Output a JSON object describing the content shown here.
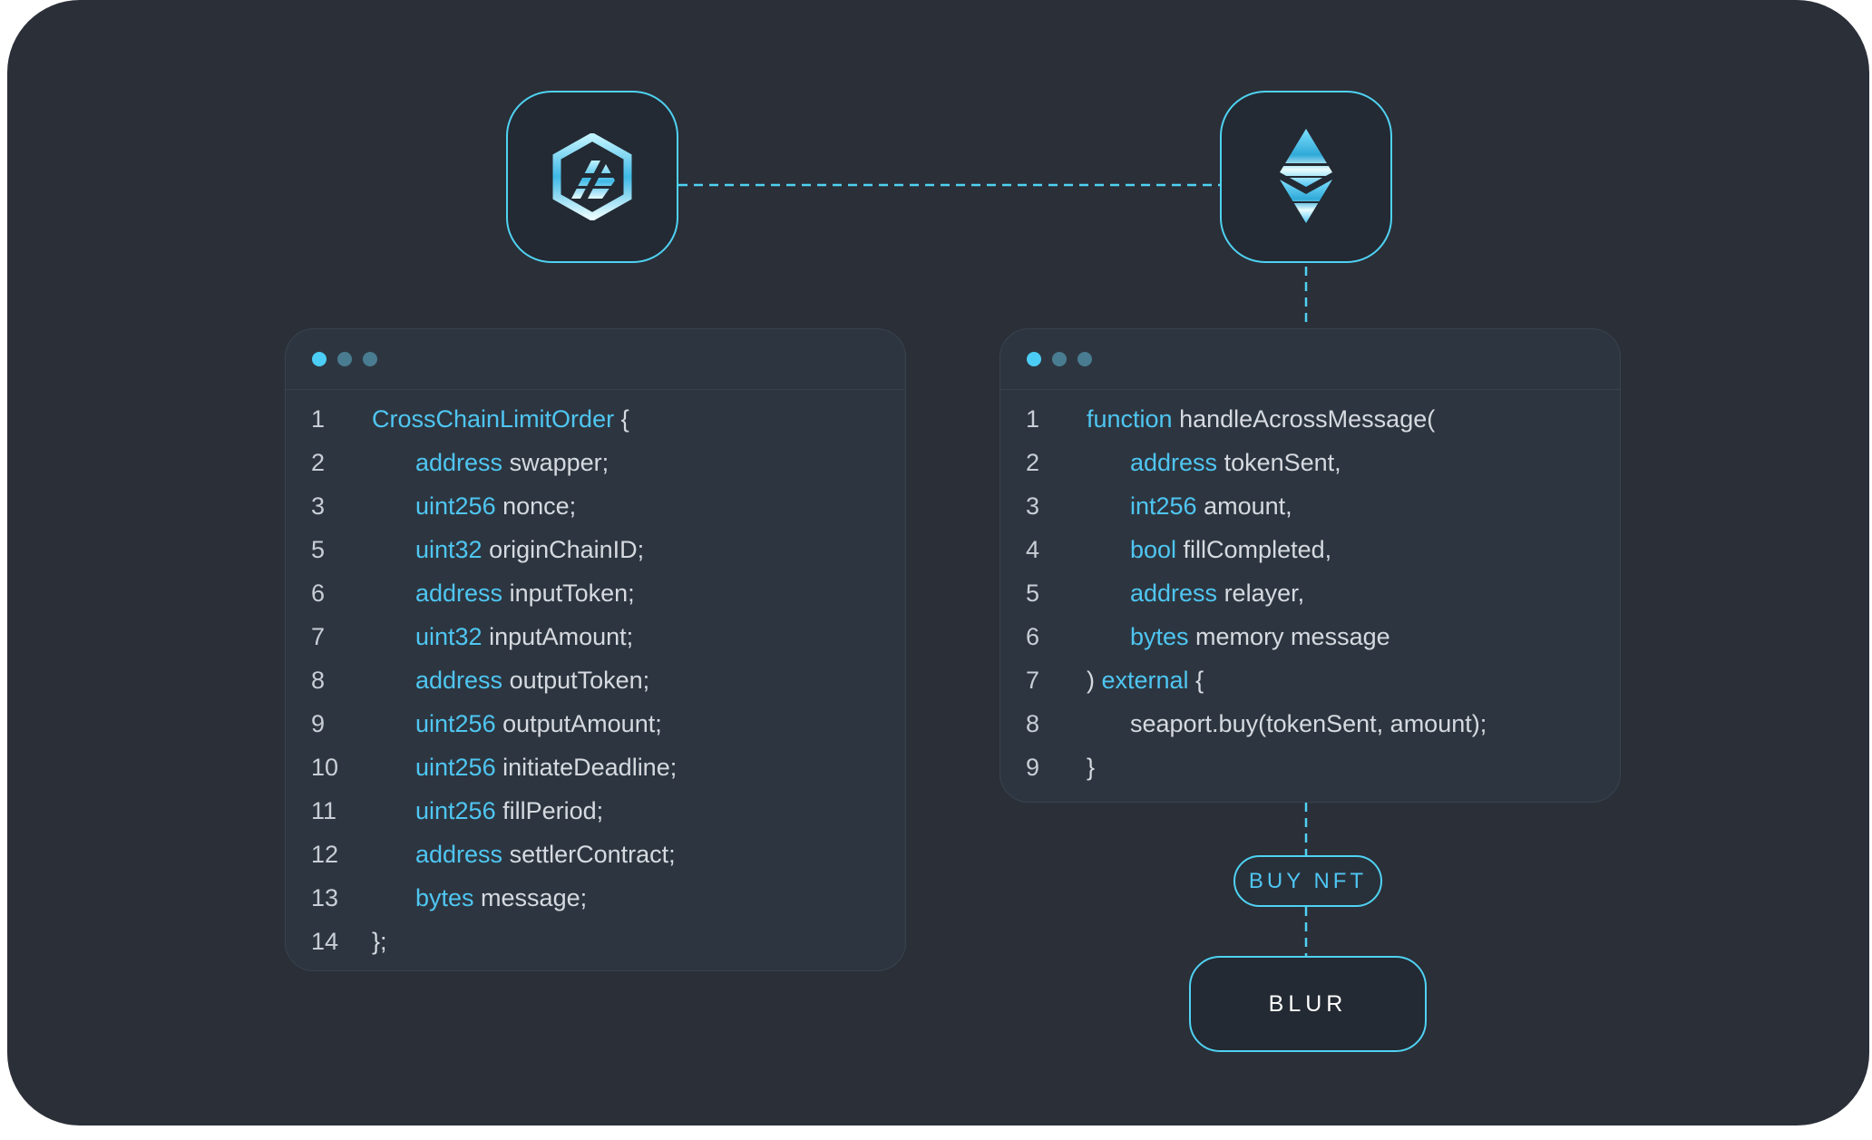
{
  "colors": {
    "background": "#2b2f38",
    "accent": "#4fd2f2",
    "keyword": "#4fc6f2",
    "text": "#d6dae0"
  },
  "nodes": {
    "across": {
      "icon": "across-protocol-logo-icon"
    },
    "ethereum": {
      "icon": "ethereum-logo-icon"
    }
  },
  "left_panel": {
    "lines": [
      {
        "n": "1",
        "kw": "CrossChainLimitOrder",
        "rest": " {",
        "indent": false
      },
      {
        "n": "2",
        "kw": "address",
        "rest": " swapper;",
        "indent": true
      },
      {
        "n": "3",
        "kw": "uint256",
        "rest": " nonce;",
        "indent": true
      },
      {
        "n": "5",
        "kw": "uint32",
        "rest": " originChainID;",
        "indent": true
      },
      {
        "n": "6",
        "kw": "address",
        "rest": " inputToken;",
        "indent": true
      },
      {
        "n": "7",
        "kw": "uint32",
        "rest": " inputAmount;",
        "indent": true
      },
      {
        "n": "8",
        "kw": "address",
        "rest": " outputToken;",
        "indent": true
      },
      {
        "n": "9",
        "kw": "uint256",
        "rest": " outputAmount;",
        "indent": true
      },
      {
        "n": "10",
        "kw": "uint256",
        "rest": " initiateDeadline;",
        "indent": true
      },
      {
        "n": "11",
        "kw": "uint256",
        "rest": " fillPeriod;",
        "indent": true
      },
      {
        "n": "12",
        "kw": "address",
        "rest": " settlerContract;",
        "indent": true
      },
      {
        "n": "13",
        "kw": "bytes",
        "rest": " message;",
        "indent": true
      },
      {
        "n": "14",
        "kw": "",
        "rest": "};",
        "indent": false
      }
    ]
  },
  "right_panel": {
    "lines": [
      {
        "n": "1",
        "kw": "function",
        "rest": " handleAcrossMessage(",
        "indent": false
      },
      {
        "n": "2",
        "kw": "address",
        "rest": " tokenSent,",
        "indent": true
      },
      {
        "n": "3",
        "kw": "int256",
        "rest": " amount,",
        "indent": true
      },
      {
        "n": "4",
        "kw": "bool",
        "rest": " fillCompleted,",
        "indent": true
      },
      {
        "n": "5",
        "kw": "address",
        "rest": " relayer,",
        "indent": true
      },
      {
        "n": "6",
        "kw": "bytes",
        "rest": " memory message",
        "indent": true
      },
      {
        "n": "7",
        "pre": ") ",
        "kw": "external",
        "rest": " {",
        "indent": false
      },
      {
        "n": "8",
        "kw": "",
        "rest": "seaport.buy(tokenSent, amount);",
        "indent": true
      },
      {
        "n": "9",
        "kw": "",
        "rest": "}",
        "indent": false
      }
    ]
  },
  "buy_nft_label": "BUY NFT",
  "blur_label": "BLUR"
}
